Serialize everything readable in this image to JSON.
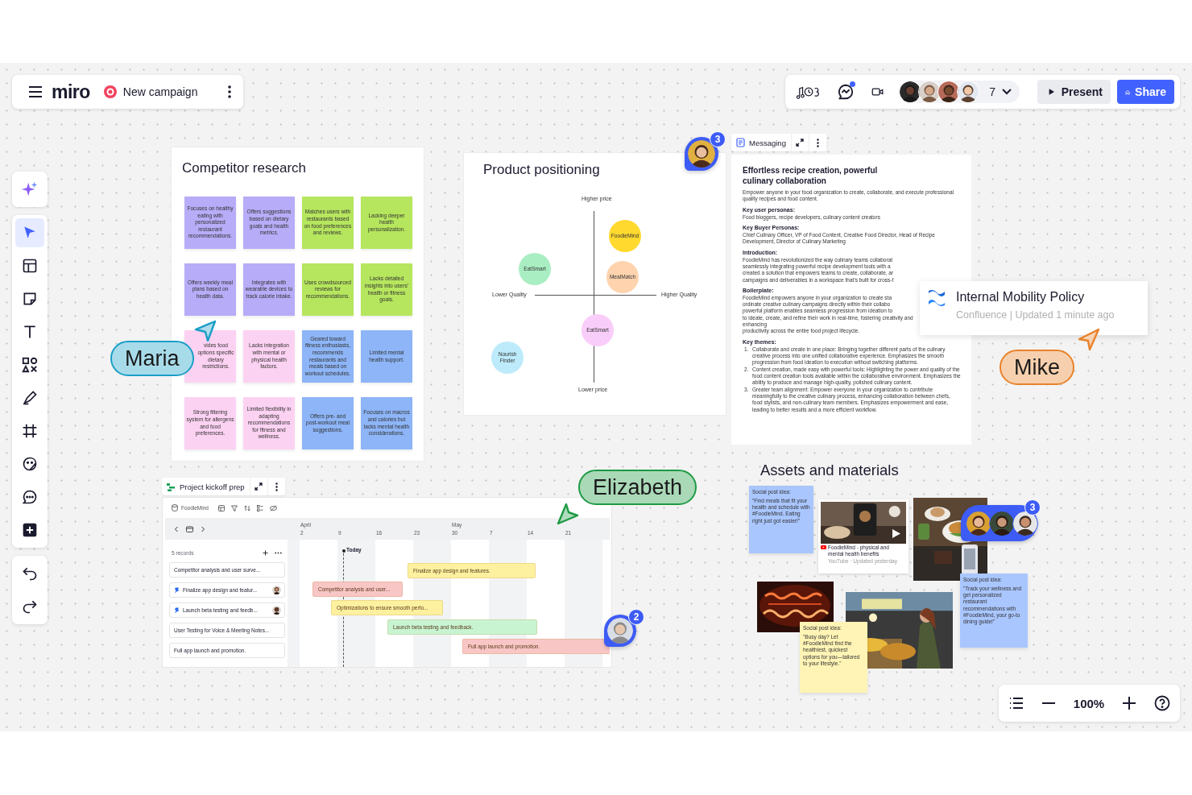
{
  "board_bar": {
    "logo": "miro",
    "board_name": "New campaign"
  },
  "top_bar": {
    "chat_unread": true,
    "collaborator_count": "7",
    "buttons": [
      {
        "label": "Present",
        "kind": "secondary"
      },
      {
        "label": "Share",
        "kind": "primary"
      }
    ]
  },
  "tool_groups": [
    {
      "tools": [
        {
          "kind": "ai",
          "selected": false
        }
      ]
    },
    {
      "tools": [
        {
          "kind": "select",
          "selected": true
        },
        {
          "kind": "templates",
          "selected": false
        },
        {
          "kind": "sticky",
          "selected": false
        },
        {
          "kind": "text",
          "selected": false
        },
        {
          "kind": "shapes",
          "selected": false
        },
        {
          "kind": "pen",
          "selected": false
        },
        {
          "kind": "frame",
          "selected": false
        },
        {
          "kind": "stickers",
          "selected": false
        },
        {
          "kind": "comment",
          "selected": false
        },
        {
          "kind": "more",
          "selected": false
        }
      ]
    },
    {
      "tools": [
        {
          "kind": "undo",
          "selected": false
        },
        {
          "kind": "redo",
          "selected": false
        }
      ]
    }
  ],
  "competitor_research": {
    "title": "Competitor research",
    "notes": [
      {
        "text": "Focuses on healthy eating with personalized restaurant recommendations.",
        "color": "#b7acf7"
      },
      {
        "text": "Offers suggestions based on dietary goals and health metrics.",
        "color": "#b7acf7"
      },
      {
        "text": "Matches users with restaurants based on food preferences and reviews.",
        "color": "#b6e65e"
      },
      {
        "text": "Lacking deeper health personalization.",
        "color": "#b6e65e"
      },
      {
        "text": "Offers weekly meal plans based on health data.",
        "color": "#b7acf7"
      },
      {
        "text": "Integrates with wearable devices to track calorie intake.",
        "color": "#b7acf7"
      },
      {
        "text": "Uses crowdsourced reviews for recommendations.",
        "color": "#b6e65e"
      },
      {
        "text": "Lacks detailed insights into users' health or fitness goals.",
        "color": "#b6e65e"
      },
      {
        "text": "vides food options specific dietary restrictions.",
        "color": "#fcd2f2"
      },
      {
        "text": "Lacks integration with mental or physical health factors.",
        "color": "#fcd2f2"
      },
      {
        "text": "Geared toward fitness enthusiasts, recommends restaurants and meals based on workout schedules.",
        "color": "#8db5f7"
      },
      {
        "text": "Limited mental health support.",
        "color": "#8db5f7"
      },
      {
        "text": "Strong filtering system for allergens and food preferences.",
        "color": "#fcd2f2"
      },
      {
        "text": "Limited flexibility in adapting recommendations for fitness and wellness.",
        "color": "#fcd2f2"
      },
      {
        "text": "Offers pre- and post-workout meal suggestions.",
        "color": "#8db5f7"
      },
      {
        "text": "Focuses on macros and calories but lacks mental health considerations.",
        "color": "#8db5f7"
      }
    ]
  },
  "product_positioning": {
    "title": "Product positioning",
    "comment_count": "3",
    "axis_labels": {
      "top": "Higher price",
      "bottom": "Lower price",
      "left": "Lower Quality",
      "right": "Higher Quality"
    },
    "products": [
      {
        "name": "FoodieMind",
        "color": "#ffd92e"
      },
      {
        "name": "EatSmart",
        "color": "#a9eec2"
      },
      {
        "name": "MealMatch",
        "color": "#fed3ad"
      },
      {
        "name": "EatSmart",
        "color": "#f9cdf9"
      },
      {
        "name": "Nourish Finder",
        "color": "#bdebfb"
      }
    ]
  },
  "messaging": {
    "tab": "Messaging",
    "doc": {
      "title": "Effortless recipe creation, powerful culinary collaboration",
      "intro": "Empower anyone in your food organization to create, collaborate, and execute professional quality recipes and food content.",
      "sections": [
        {
          "heading": "Key user personas:",
          "paragraphs": [
            "Food bloggers, recipe developers, culinary content creators"
          ]
        },
        {
          "heading": "Key Buyer Personas:",
          "paragraphs": [
            "Chief Culinary Officer, VP of Food Content, Creative Food Director, Head of Recipe Development, Director of Culinary Marketing"
          ]
        },
        {
          "heading": "Introduction:",
          "lines": [
            "FoodieMind has revolutionized the way culinary teams collaborat",
            "seamlessly integrating powerful recipe development tools with a",
            "created a solution that empowers teams to create, collaborate, ar",
            "campaigns and deliverables in a workspace that's built for cross-f"
          ]
        },
        {
          "heading": "Boilerplate:",
          "lines": [
            "FoodieMind empowers anyone in your organization to create sta",
            "ordinate creative culinary campaigns directly within their collabo",
            "powerful platform enables seamless progression from ideation to",
            "to ideate, create, and refine their work in real-time, fostering creativity and enhancing",
            "productivity across the entire food project lifecycle."
          ]
        },
        {
          "heading": "Key themes:",
          "items": [
            {
              "number": "1.",
              "text": "Collaborate and create in one place: Bringing together different parts of the culinary creative process into one unified collaborative experience. Emphasizes the smooth progression from food ideation to execution without switching platforms."
            },
            {
              "number": "2.",
              "text": "Content creation, made easy with powerful tools: Highlighting the power and quality of the food content creation tools available within the collaborative environment. Emphasizes the ability to produce and manage high-quality, polished culinary content."
            },
            {
              "number": "3.",
              "text": "Greater team alignment: Empower everyone in your organization to contribute meaningfully to the creative culinary process, enhancing collaboration between chefs, food stylists, and non-culinary team members. Emphasizes empowerment and ease, leading to better results and a more efficient workflow."
            }
          ]
        }
      ]
    }
  },
  "confluence_card": {
    "title": "Internal Mobility Policy",
    "meta": "Confluence | Updated 1 minute ago"
  },
  "gantt": {
    "tab": "Project kickoff prep",
    "source": "FoodieMind",
    "records_label": "5 records",
    "comment_count": "2",
    "months": [
      "April",
      "May"
    ],
    "dates": [
      "2",
      "9",
      "16",
      "23",
      "30",
      "7",
      "14",
      "21"
    ],
    "today_label": "Today",
    "records": [
      {
        "text": "Competitor analysis and user surve...",
        "pinned": false,
        "assigned": false
      },
      {
        "text": "Finalize app design and featur...",
        "pinned": true,
        "assigned": true
      },
      {
        "text": "Launch beta testing and feedb...",
        "pinned": true,
        "assigned": true
      },
      {
        "text": "User Testing for Voice & Meeting Notes...",
        "pinned": false,
        "assigned": false
      },
      {
        "text": "Full app launch and promotion.",
        "pinned": false,
        "assigned": false
      }
    ],
    "bars": [
      {
        "text": "Finalize app design and features.",
        "color": "#fdf1a0"
      },
      {
        "text": "Competitor analysis and user...",
        "color": "#f9c6c6"
      },
      {
        "text": "Optimizations to ensure smooth perfo...",
        "color": "#fdf1a0"
      },
      {
        "text": "Launch beta testing and feedback.",
        "color": "#c8f4d2"
      },
      {
        "text": "Full app launch and promotion.",
        "color": "#f9c6c6"
      }
    ]
  },
  "cursors": [
    {
      "name": "Maria",
      "color": "#1a9fc7"
    },
    {
      "name": "Mike",
      "color": "#e8822a"
    },
    {
      "name": "Elizabeth",
      "color": "#1e9a44"
    }
  ],
  "assets": {
    "title": "Assets and materials",
    "comment_count": "3",
    "items": [
      {
        "kind": "sticky",
        "color": "#a9c6ff",
        "label": "Social post idea:",
        "text": "\"Find meals that fit your health and schedule with #FoodieMind. Eating right just got easier!\""
      },
      {
        "kind": "video",
        "title": "FoodieMind - physical and mental health benefits",
        "meta": "YouTube · Updated yesterday"
      },
      {
        "kind": "picture"
      },
      {
        "kind": "picture"
      },
      {
        "kind": "picture"
      },
      {
        "kind": "sticky",
        "color": "#a9c6ff",
        "label": "Social post idea:",
        "text": "\"Track your wellness and get personalized restaurant recommendations with #FoodieMind, your go-to dining guide!\""
      },
      {
        "kind": "sticky",
        "color": "#fff4b5",
        "label": "Social post idea:",
        "text": "\"Busy day? Let #FoodieMind find the healthiest, quickest options for you—tailored to your lifestyle.\""
      }
    ]
  },
  "zoom": {
    "level": "100%"
  }
}
